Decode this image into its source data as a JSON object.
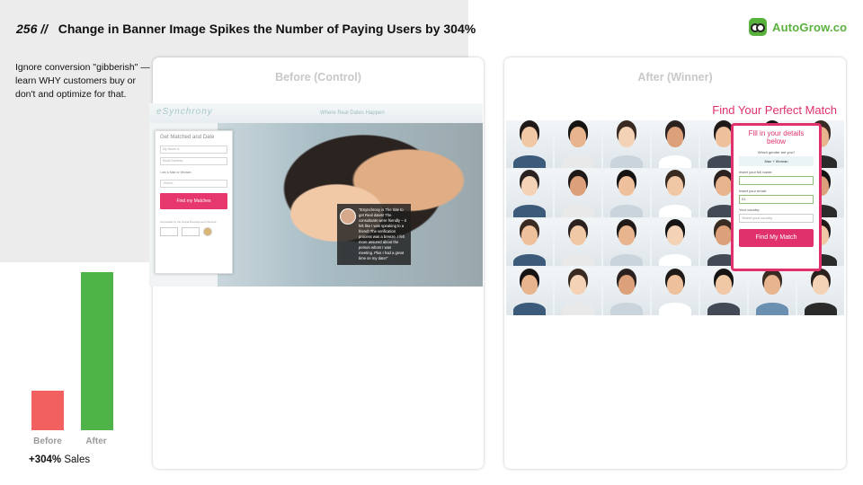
{
  "header": {
    "number": "256 //",
    "title": "Change in Banner Image Spikes the Number of Paying Users by 304%"
  },
  "note": "Ignore conversion \"gibberish\" — learn WHY customers buy or don't and optimize for that.",
  "logo": {
    "text": "AutoGrow.co",
    "icon": "owl-logo-icon",
    "color": "#5ab23e"
  },
  "before": {
    "title": "Before (Control)",
    "brand": "eSynchrony",
    "tagline": "Where Real Dates Happen",
    "form": {
      "heading": "Get Matched and Date",
      "name_placeholder": "My Name is",
      "email_placeholder": "Email Address",
      "iam": "I am a     Man  or   Woman",
      "select": "-Select-",
      "button": "Find my Matches",
      "accredited": "Accredited by the Social Development Network"
    },
    "testimonial": "\"ESynchrony is The Site to get Real dates! The consultants were friendly – it felt like I was speaking to a friend! The verification process was a breeze. I felt more assured about the person whom I was meeting. Plus I had a great time on my date!\""
  },
  "after": {
    "title": "After (Winner)",
    "headline": "Find Your Perfect Match",
    "form": {
      "heading": "Fill in your details below",
      "gender_label": "Which gender are you?",
      "gender_options": "Man  +  Woman",
      "name_label": "Insert your full name:",
      "email_label": "Insert your email:",
      "email_value": "01",
      "country_label": "Your country:",
      "country_placeholder": "Select your country",
      "button": "Find My Match"
    }
  },
  "bar_chart": {
    "before_label": "Before",
    "after_label": "After",
    "before_value": 1.0,
    "after_value": 4.04,
    "before_color": "#f2605f",
    "after_color": "#4fb447"
  },
  "result": {
    "highlight": "+304%",
    "label": "Sales"
  },
  "colors": {
    "accent_pink": "#e0316d",
    "panel_grey": "#ececec"
  }
}
